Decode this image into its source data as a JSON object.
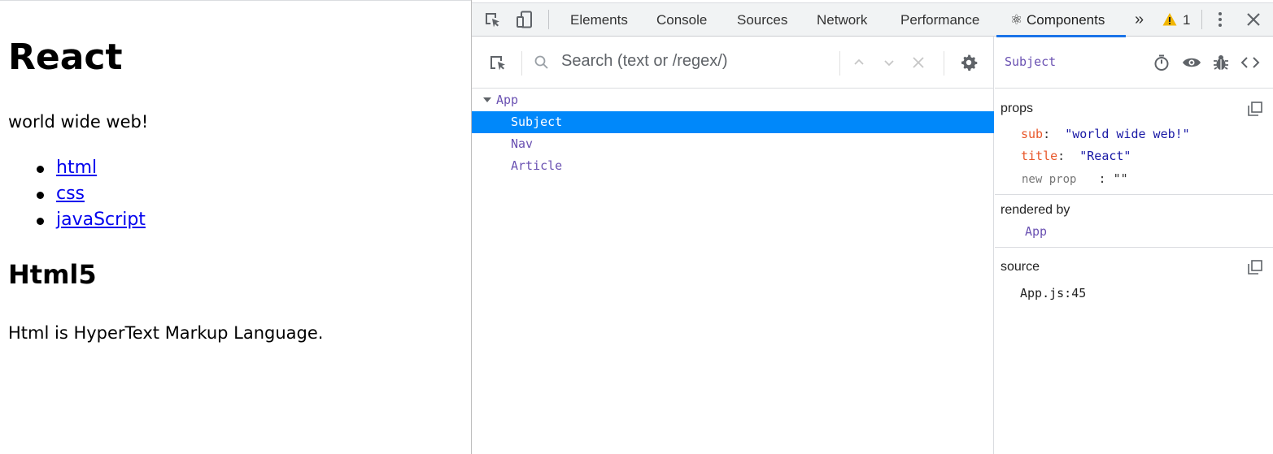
{
  "page": {
    "heading": "React",
    "subtitle": "world wide web!",
    "links": [
      "html",
      "css",
      "javaScript"
    ],
    "section_heading": "Html5",
    "section_text": "Html is HyperText Markup Language."
  },
  "devtools": {
    "tabs": [
      "Elements",
      "Console",
      "Sources",
      "Network",
      "Performance",
      "⚛ Components"
    ],
    "active_tab": "⚛ Components",
    "more_tabs": "»",
    "warning_count": "1",
    "search": {
      "placeholder": "Search (text or /regex/)"
    },
    "tree": [
      {
        "label": "App",
        "depth": 0,
        "expanded": true,
        "selected": false
      },
      {
        "label": "Subject",
        "depth": 1,
        "selected": true
      },
      {
        "label": "Nav",
        "depth": 1,
        "selected": false
      },
      {
        "label": "Article",
        "depth": 1,
        "selected": false
      }
    ],
    "inspector": {
      "component": "Subject",
      "props_title": "props",
      "props": [
        {
          "key": "sub",
          "value": "\"world wide web!\""
        },
        {
          "key": "title",
          "value": "\"React\""
        }
      ],
      "new_prop_label": "new prop",
      "new_prop_value": "\"\"",
      "rendered_by_title": "rendered by",
      "rendered_by": "App",
      "source_title": "source",
      "source": "App.js:45"
    }
  },
  "colors": {
    "accent": "#1a73e8",
    "selected_row": "#0088fa",
    "component_name": "#6a51b2",
    "prop_key": "#e8572a",
    "prop_value": "#1a1aa6",
    "warning": "#f2b600"
  }
}
